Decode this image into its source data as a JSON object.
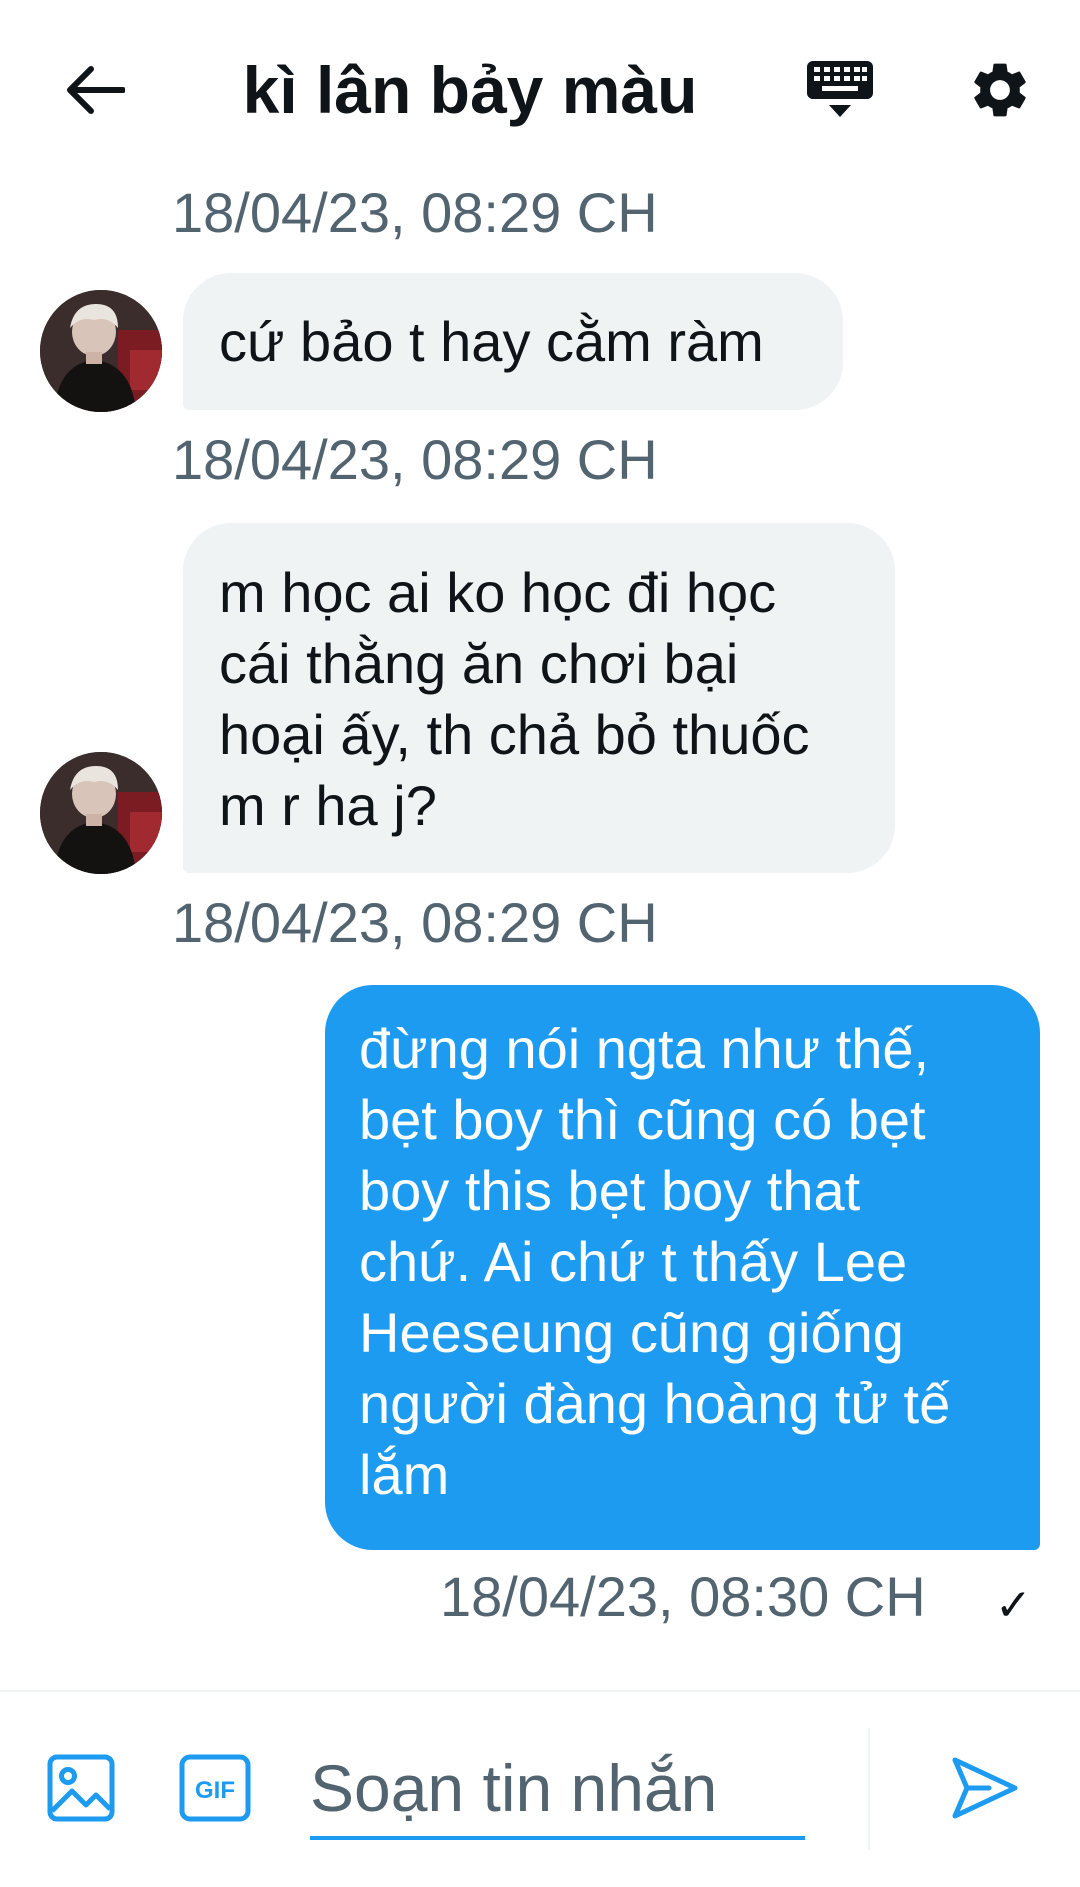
{
  "header": {
    "title": "kì lân bảy màu",
    "back_icon": "arrow-left-icon",
    "keyboard_icon": "keyboard-icon",
    "settings_icon": "gear-icon"
  },
  "messages": [
    {
      "timestamp": "18/04/23, 08:29 CH",
      "direction": "incoming",
      "text": "cứ bảo t hay cằm ràm"
    },
    {
      "timestamp": "18/04/23, 08:29 CH",
      "direction": "incoming",
      "lines": [
        "m học ai ko học đi học",
        "cái thằng ăn chơi bại",
        "hoại ấy, th chả bỏ thuốc",
        "m r ha j?"
      ]
    },
    {
      "timestamp": "18/04/23, 08:29 CH",
      "direction": "outgoing",
      "lines": [
        "đừng nói ngta như thế,",
        "bẹt boy thì cũng có bẹt",
        "boy this bẹt boy that",
        "chứ. Ai chứ t thấy Lee",
        "Heeseung cũng giống",
        "người đàng hoàng tử tế",
        "lắm"
      ]
    }
  ],
  "last_timestamp": "18/04/23, 08:30 CH",
  "read_check": "✓",
  "composer": {
    "placeholder": "Soạn tin nhắn",
    "value": "",
    "image_icon": "image-icon",
    "gif_icon": "gif-icon",
    "send_icon": "send-icon"
  },
  "colors": {
    "accent": "#1d9bf0",
    "incoming_bubble": "#eff3f4",
    "timestamp": "#536471",
    "text": "#0f1419"
  }
}
